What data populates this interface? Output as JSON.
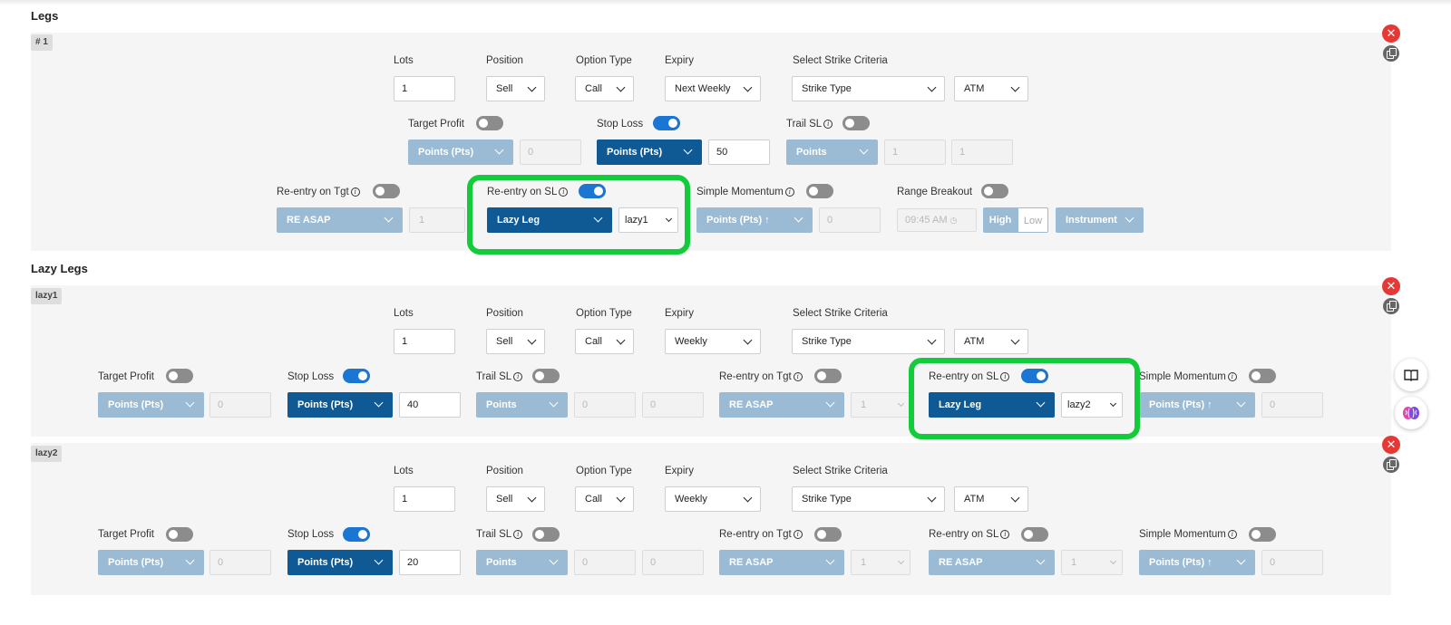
{
  "sections": {
    "legs_title": "Legs",
    "lazy_title": "Lazy Legs"
  },
  "labels": {
    "lots": "Lots",
    "position": "Position",
    "option_type": "Option Type",
    "expiry": "Expiry",
    "strike_criteria": "Select Strike Criteria",
    "target_profit": "Target Profit",
    "stop_loss": "Stop Loss",
    "trail_sl": "Trail SL",
    "reentry_tgt": "Re-entry on Tgt",
    "reentry_sl": "Re-entry on SL",
    "simple_momentum": "Simple Momentum",
    "range_breakout": "Range Breakout",
    "info_glyph": "i"
  },
  "leg1": {
    "tag": "# 1",
    "lots": "1",
    "position": "Sell",
    "option_type": "Call",
    "expiry": "Next Weekly",
    "strike_type": "Strike Type",
    "strike_value": "ATM",
    "target_profit": {
      "on": false,
      "type": "Points (Pts)",
      "value": "0"
    },
    "stop_loss": {
      "on": true,
      "type": "Points (Pts)",
      "value": "50"
    },
    "trail_sl": {
      "on": false,
      "type": "Points",
      "value1": "1",
      "value2": "1"
    },
    "reentry_tgt": {
      "on": false,
      "type": "RE ASAP",
      "count": "1"
    },
    "reentry_sl": {
      "on": true,
      "type": "Lazy Leg",
      "target": "lazy1"
    },
    "simple_momentum": {
      "on": false,
      "type": "Points (Pts) ↑",
      "value": "0"
    },
    "range_breakout": {
      "on": false,
      "time": "09:45 AM",
      "high": "High",
      "low": "Low",
      "instrument": "Instrument"
    }
  },
  "lazy1": {
    "tag": "lazy1",
    "lots": "1",
    "position": "Sell",
    "option_type": "Call",
    "expiry": "Weekly",
    "strike_type": "Strike Type",
    "strike_value": "ATM",
    "target_profit": {
      "on": false,
      "type": "Points (Pts)",
      "value": "0"
    },
    "stop_loss": {
      "on": true,
      "type": "Points (Pts)",
      "value": "40"
    },
    "trail_sl": {
      "on": false,
      "type": "Points",
      "value1": "0",
      "value2": "0"
    },
    "reentry_tgt": {
      "on": false,
      "type": "RE ASAP",
      "count": "1"
    },
    "reentry_sl": {
      "on": true,
      "type": "Lazy Leg",
      "target": "lazy2"
    },
    "simple_momentum": {
      "on": false,
      "type": "Points (Pts) ↑",
      "value": "0"
    }
  },
  "lazy2": {
    "tag": "lazy2",
    "lots": "1",
    "position": "Sell",
    "option_type": "Call",
    "expiry": "Weekly",
    "strike_type": "Strike Type",
    "strike_value": "ATM",
    "target_profit": {
      "on": false,
      "type": "Points (Pts)",
      "value": "0"
    },
    "stop_loss": {
      "on": true,
      "type": "Points (Pts)",
      "value": "20"
    },
    "trail_sl": {
      "on": false,
      "type": "Points",
      "value1": "0",
      "value2": "0"
    },
    "reentry_tgt": {
      "on": false,
      "type": "RE ASAP",
      "count": "1"
    },
    "reentry_sl": {
      "on": false,
      "type": "RE ASAP",
      "count": "1"
    },
    "simple_momentum": {
      "on": false,
      "type": "Points (Pts) ↑",
      "value": "0"
    }
  },
  "icons": {
    "close": "✕",
    "copy": "copy-icon",
    "book": "book-icon",
    "brain": "brain-icon"
  },
  "colors": {
    "highlight": "#12cc3c",
    "dark_dropdown": "#0f5a94",
    "light_dropdown": "#9bbbd4",
    "toggle_on": "#1a76d2",
    "close": "#e53935"
  }
}
